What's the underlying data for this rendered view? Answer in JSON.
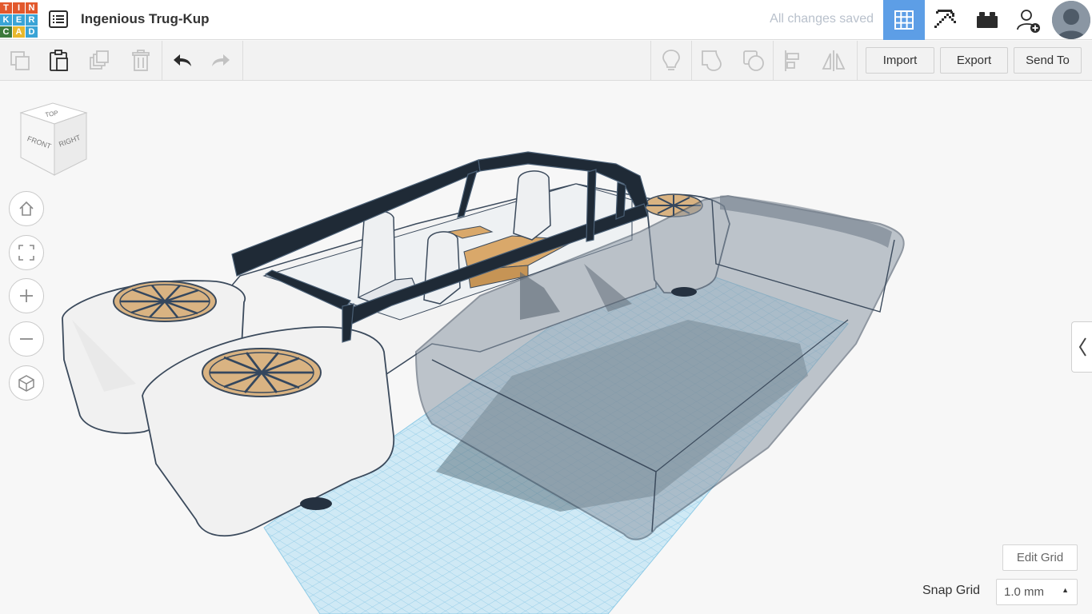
{
  "app": {
    "logo_letters": [
      "T",
      "I",
      "N",
      "K",
      "E",
      "R",
      "C",
      "A",
      "D"
    ],
    "logo_colors": [
      "#e2582c",
      "#e2582c",
      "#e2582c",
      "#3aa4d6",
      "#3aa4d6",
      "#3aa4d6",
      "#3d7a3c",
      "#e8b82d",
      "#3aa4d6"
    ],
    "project_title": "Ingenious Trug-Kup",
    "save_status": "All changes saved",
    "accent_color": "#5d9ee6"
  },
  "toolbar": {
    "import_label": "Import",
    "export_label": "Export",
    "send_to_label": "Send To"
  },
  "viewcube": {
    "top": "TOP",
    "front": "FRONT",
    "right": "RIGHT"
  },
  "workplane": {
    "edit_grid_label": "Edit Grid",
    "snap_grid_label": "Snap Grid",
    "snap_grid_value": "1.0 mm"
  }
}
